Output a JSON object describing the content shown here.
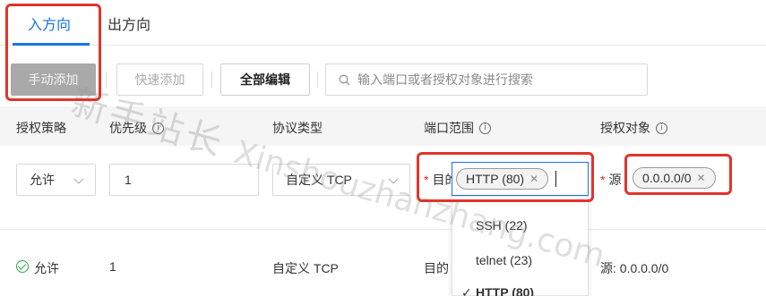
{
  "tabs": [
    {
      "label": "入方向",
      "active": true
    },
    {
      "label": "出方向",
      "active": false
    }
  ],
  "toolbar": {
    "manual_add": "手动添加",
    "quick_add": "快速添加",
    "edit_all": "全部编辑",
    "search_placeholder": "输入端口或者授权对象进行搜索"
  },
  "table": {
    "headers": {
      "policy": "授权策略",
      "priority": "优先级",
      "protocol": "协议类型",
      "port_range": "端口范围",
      "auth_object": "授权对象"
    },
    "edit_row": {
      "policy": "允许",
      "priority": "1",
      "protocol": "自定义 TCP",
      "port_label": "目的",
      "port_tag": "HTTP (80)",
      "source_label": "源",
      "source_tag": "0.0.0.0/0"
    },
    "dropdown_options": [
      "SSH (22)",
      "telnet (23)",
      "HTTP (80)"
    ],
    "dropdown_selected": "HTTP (80)",
    "rows": [
      {
        "policy": "允许",
        "priority": "1",
        "protocol": "自定义 TCP",
        "port": "目的",
        "auth_object": "源: 0.0.0.0/0"
      }
    ]
  },
  "watermark": {
    "cn": "新手站长",
    "en": "Xinshouzhanzhang.com"
  },
  "colors": {
    "accent": "#1a73e8",
    "highlight": "#e0352b",
    "success": "#2eaa4a"
  }
}
